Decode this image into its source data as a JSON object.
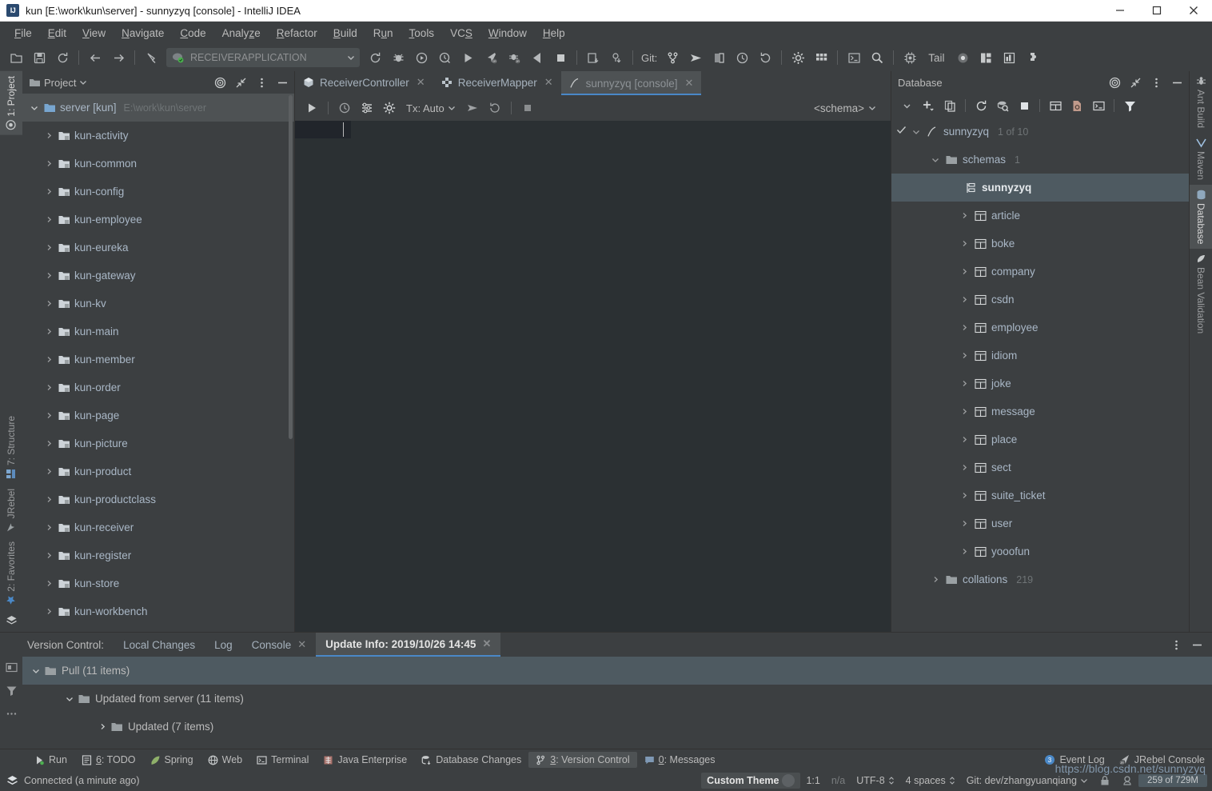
{
  "window": {
    "title": "kun [E:\\work\\kun\\server] - sunnyzyq [console] - IntelliJ IDEA",
    "app_icon": "intellij-idea-icon"
  },
  "menubar": {
    "items": [
      {
        "label": "File"
      },
      {
        "label": "Edit"
      },
      {
        "label": "View"
      },
      {
        "label": "Navigate"
      },
      {
        "label": "Code"
      },
      {
        "label": "Analyze"
      },
      {
        "label": "Refactor"
      },
      {
        "label": "Build"
      },
      {
        "label": "Run"
      },
      {
        "label": "Tools"
      },
      {
        "label": "VCS"
      },
      {
        "label": "Window"
      },
      {
        "label": "Help"
      }
    ]
  },
  "toolbar": {
    "run_config": "RECEIVERAPPLICATION",
    "git_label": "Git:",
    "tail_label": "Tail"
  },
  "project_panel": {
    "title": "Project",
    "root": {
      "label": "server [kun]",
      "path": "E:\\work\\kun\\server"
    },
    "modules": [
      {
        "label": "kun-activity"
      },
      {
        "label": "kun-common"
      },
      {
        "label": "kun-config"
      },
      {
        "label": "kun-employee"
      },
      {
        "label": "kun-eureka"
      },
      {
        "label": "kun-gateway"
      },
      {
        "label": "kun-kv"
      },
      {
        "label": "kun-main"
      },
      {
        "label": "kun-member"
      },
      {
        "label": "kun-order"
      },
      {
        "label": "kun-page"
      },
      {
        "label": "kun-picture"
      },
      {
        "label": "kun-product"
      },
      {
        "label": "kun-productclass"
      },
      {
        "label": "kun-receiver"
      },
      {
        "label": "kun-register"
      },
      {
        "label": "kun-store"
      },
      {
        "label": "kun-workbench"
      }
    ]
  },
  "editor": {
    "tabs": [
      {
        "label": "ReceiverController",
        "icon": "java-class-icon",
        "active": false
      },
      {
        "label": "ReceiverMapper",
        "icon": "mapper-icon",
        "active": false
      },
      {
        "label": "sunnyzyq [console]",
        "icon": "console-icon",
        "active": true
      }
    ],
    "console_toolbar": {
      "tx_label": "Tx: Auto",
      "schema_label": "<schema>"
    }
  },
  "database_panel": {
    "title": "Database",
    "tree": [
      {
        "level": 0,
        "label": "sunnyzyq",
        "count": "1 of 10",
        "icon": "datasource-icon",
        "expanded": true,
        "selected": false
      },
      {
        "level": 1,
        "label": "schemas",
        "count": "1",
        "icon": "folder-icon",
        "expanded": true,
        "selected": false
      },
      {
        "level": 2,
        "label": "sunnyzyq",
        "count": "",
        "icon": "schema-icon",
        "expanded": false,
        "selected": true
      },
      {
        "level": 3,
        "label": "article",
        "count": "",
        "icon": "table-icon",
        "expanded": false,
        "selected": false
      },
      {
        "level": 3,
        "label": "boke",
        "count": "",
        "icon": "table-icon",
        "expanded": false,
        "selected": false
      },
      {
        "level": 3,
        "label": "company",
        "count": "",
        "icon": "table-icon",
        "expanded": false,
        "selected": false
      },
      {
        "level": 3,
        "label": "csdn",
        "count": "",
        "icon": "table-icon",
        "expanded": false,
        "selected": false
      },
      {
        "level": 3,
        "label": "employee",
        "count": "",
        "icon": "table-icon",
        "expanded": false,
        "selected": false
      },
      {
        "level": 3,
        "label": "idiom",
        "count": "",
        "icon": "table-icon",
        "expanded": false,
        "selected": false
      },
      {
        "level": 3,
        "label": "joke",
        "count": "",
        "icon": "table-icon",
        "expanded": false,
        "selected": false
      },
      {
        "level": 3,
        "label": "message",
        "count": "",
        "icon": "table-icon",
        "expanded": false,
        "selected": false
      },
      {
        "level": 3,
        "label": "place",
        "count": "",
        "icon": "table-icon",
        "expanded": false,
        "selected": false
      },
      {
        "level": 3,
        "label": "sect",
        "count": "",
        "icon": "table-icon",
        "expanded": false,
        "selected": false
      },
      {
        "level": 3,
        "label": "suite_ticket",
        "count": "",
        "icon": "table-icon",
        "expanded": false,
        "selected": false
      },
      {
        "level": 3,
        "label": "user",
        "count": "",
        "icon": "table-icon",
        "expanded": false,
        "selected": false
      },
      {
        "level": 3,
        "label": "yooofun",
        "count": "",
        "icon": "table-icon",
        "expanded": false,
        "selected": false
      },
      {
        "level": 1,
        "label": "collations",
        "count": "219",
        "icon": "folder-icon",
        "expanded": false,
        "selected": false
      }
    ]
  },
  "version_control": {
    "label": "Version Control:",
    "tabs": [
      {
        "label": "Local Changes",
        "closable": false,
        "active": false
      },
      {
        "label": "Log",
        "closable": false,
        "active": false
      },
      {
        "label": "Console",
        "closable": true,
        "active": false
      },
      {
        "label": "Update Info: 2019/10/26 14:45",
        "closable": true,
        "active": true
      }
    ],
    "rows": [
      {
        "level": 0,
        "label": "Pull (11 items)",
        "expanded": true,
        "selected": true
      },
      {
        "level": 1,
        "label": "Updated from server (11 items)",
        "expanded": true,
        "selected": false
      },
      {
        "level": 2,
        "label": "Updated (7 items)",
        "expanded": false,
        "selected": false
      }
    ]
  },
  "left_stripe": {
    "top": [
      {
        "label": "1: Project",
        "icon": "project-icon",
        "active": true
      }
    ],
    "bottom": [
      {
        "label": "7: Structure",
        "icon": "structure-icon",
        "active": false
      },
      {
        "label": "JRebel",
        "icon": "jrebel-icon",
        "active": false
      },
      {
        "label": "2: Favorites",
        "icon": "star-icon",
        "active": false
      }
    ]
  },
  "right_stripe": {
    "items": [
      {
        "label": "Ant Build",
        "icon": "ant-icon",
        "active": false
      },
      {
        "label": "Maven",
        "icon": "maven-icon",
        "active": false
      },
      {
        "label": "Database",
        "icon": "database-icon",
        "active": true
      },
      {
        "label": "Bean Validation",
        "icon": "bean-validation-icon",
        "active": false
      }
    ]
  },
  "toolwindow_bar": {
    "left_items": [
      {
        "label": "Run",
        "icon": "run-icon",
        "active": false
      },
      {
        "label": "6: TODO",
        "icon": "todo-icon",
        "active": false
      },
      {
        "label": "Spring",
        "icon": "spring-icon",
        "active": false
      },
      {
        "label": "Web",
        "icon": "web-icon",
        "active": false
      },
      {
        "label": "Terminal",
        "icon": "terminal-icon",
        "active": false
      },
      {
        "label": "Java Enterprise",
        "icon": "java-enterprise-icon",
        "active": false
      },
      {
        "label": "Database Changes",
        "icon": "database-changes-icon",
        "active": false
      },
      {
        "label": "3: Version Control",
        "icon": "vcs-branch-icon",
        "active": true
      },
      {
        "label": "0: Messages",
        "icon": "messages-icon",
        "active": false
      }
    ],
    "right_items": [
      {
        "label": "Event Log",
        "icon": "event-log-icon",
        "active": false
      },
      {
        "label": "JRebel Console",
        "icon": "jrebel-icon",
        "active": false
      }
    ]
  },
  "statusbar": {
    "connection": "Connected (a minute ago)",
    "theme": "Custom Theme",
    "caret": "1:1",
    "na": "n/a",
    "encoding": "UTF-8",
    "indent": "4 spaces",
    "git_branch": "Git: dev/zhangyuanqiang",
    "memory": "259 of 729M",
    "watermark": "https://blog.csdn.net/sunnyzyq"
  },
  "colors": {
    "accent_blue": "#4a88c7",
    "panel_bg": "#3c3f41",
    "editor_bg": "#2b3033",
    "selection": "#4e5a61",
    "text": "#a9b7c6"
  }
}
